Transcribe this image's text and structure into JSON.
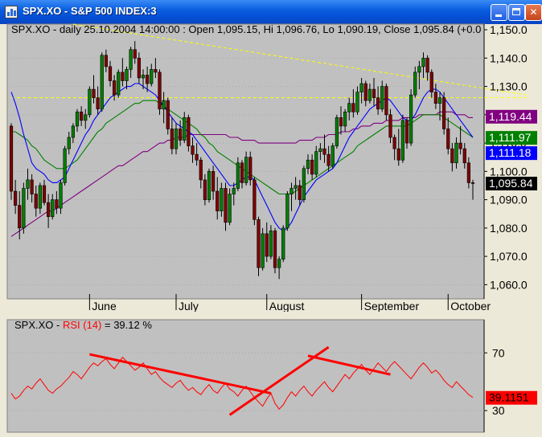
{
  "window": {
    "title": "SPX.XO - S&P 500 INDEX:3",
    "icons": [
      "chart-app-icon",
      "minimize-icon",
      "maximize-icon",
      "close-icon"
    ]
  },
  "price_panel": {
    "header": "SPX.XO - daily 25.10.2004 14:00:00 : Open 1,095.15, Hi 1,096.76, Lo 1,090.19, Close 1,095.84 (+0.0",
    "labels": [
      {
        "text": "1,119.44",
        "value": 1119.44,
        "color": "#800080"
      },
      {
        "text": "1,111.97",
        "value": 1111.97,
        "color": "#008000"
      },
      {
        "text": "1,111.18",
        "value": 1111.18,
        "color": "#0000ff"
      },
      {
        "text": "1,095.84",
        "value": 1095.84,
        "color": "#000000"
      }
    ]
  },
  "rsi_panel": {
    "header_prefix": "SPX.XO - ",
    "header_indicator": "RSI (14)",
    "header_suffix": " = 39.12 %",
    "value_label": "39.1151",
    "value": 39.1151
  },
  "colors": {
    "plot_bg": "#c0c0c0",
    "up_candle": "#008000",
    "down_candle": "#800000",
    "ma_blue": "#0000ff",
    "ma_green": "#008000",
    "ma_purple": "#800080",
    "trendline_yellow": "#ffff00",
    "rsi_line": "#ff0000"
  },
  "chart_data": [
    {
      "type": "candlestick",
      "ylim": [
        1055,
        1152
      ],
      "yticks": [
        1060,
        1070,
        1080,
        1090,
        1100,
        1110,
        1120,
        1130,
        1140,
        1150
      ],
      "ytick_labels": [
        "1,060.0",
        "1,070.0",
        "1,080.0",
        "1,090.0",
        "1,100.0",
        "1,110.0",
        "1,120.0",
        "1,130.0",
        "1,140.0",
        "1,150.0"
      ],
      "month_labels": [
        {
          "label": "June",
          "index": 19
        },
        {
          "label": "July",
          "index": 40
        },
        {
          "label": "August",
          "index": 62
        },
        {
          "label": "September",
          "index": 85
        },
        {
          "label": "October",
          "index": 106
        }
      ],
      "ohlc": [
        [
          1116,
          1117,
          1090,
          1093
        ],
        [
          1093,
          1097,
          1085,
          1088
        ],
        [
          1088,
          1093,
          1076,
          1080
        ],
        [
          1080,
          1096,
          1078,
          1094
        ],
        [
          1094,
          1101,
          1090,
          1097
        ],
        [
          1097,
          1099,
          1089,
          1092
        ],
        [
          1092,
          1095,
          1084,
          1087
        ],
        [
          1087,
          1096,
          1085,
          1095
        ],
        [
          1095,
          1097,
          1088,
          1089
        ],
        [
          1089,
          1092,
          1080,
          1084
        ],
        [
          1084,
          1092,
          1083,
          1090
        ],
        [
          1090,
          1093,
          1085,
          1087
        ],
        [
          1087,
          1097,
          1085,
          1096
        ],
        [
          1096,
          1109,
          1095,
          1108
        ],
        [
          1108,
          1114,
          1106,
          1112
        ],
        [
          1112,
          1117,
          1110,
          1116
        ],
        [
          1116,
          1122,
          1114,
          1121
        ],
        [
          1121,
          1123,
          1116,
          1118
        ],
        [
          1118,
          1122,
          1115,
          1120
        ],
        [
          1120,
          1130,
          1119,
          1129
        ],
        [
          1129,
          1134,
          1124,
          1126
        ],
        [
          1126,
          1130,
          1120,
          1122
        ],
        [
          1122,
          1142,
          1121,
          1141
        ],
        [
          1141,
          1143,
          1135,
          1137
        ],
        [
          1137,
          1139,
          1130,
          1132
        ],
        [
          1132,
          1134,
          1125,
          1127
        ],
        [
          1127,
          1136,
          1126,
          1135
        ],
        [
          1135,
          1140,
          1130,
          1132
        ],
        [
          1132,
          1137,
          1129,
          1136
        ],
        [
          1136,
          1144,
          1133,
          1143
        ],
        [
          1143,
          1146,
          1138,
          1140
        ],
        [
          1140,
          1142,
          1131,
          1133
        ],
        [
          1133,
          1136,
          1129,
          1134
        ],
        [
          1134,
          1137,
          1128,
          1131
        ],
        [
          1131,
          1138,
          1130,
          1136
        ],
        [
          1136,
          1140,
          1133,
          1135
        ],
        [
          1135,
          1136,
          1120,
          1122
        ],
        [
          1122,
          1128,
          1117,
          1125
        ],
        [
          1125,
          1126,
          1113,
          1115
        ],
        [
          1115,
          1119,
          1106,
          1108
        ],
        [
          1108,
          1117,
          1106,
          1115
        ],
        [
          1115,
          1118,
          1109,
          1111
        ],
        [
          1111,
          1121,
          1110,
          1119
        ],
        [
          1119,
          1120,
          1107,
          1109
        ],
        [
          1109,
          1112,
          1103,
          1106
        ],
        [
          1106,
          1110,
          1102,
          1104
        ],
        [
          1104,
          1105,
          1094,
          1097
        ],
        [
          1097,
          1099,
          1088,
          1090
        ],
        [
          1090,
          1101,
          1089,
          1100
        ],
        [
          1100,
          1102,
          1090,
          1093
        ],
        [
          1093,
          1098,
          1083,
          1086
        ],
        [
          1086,
          1096,
          1084,
          1094
        ],
        [
          1094,
          1096,
          1079,
          1082
        ],
        [
          1082,
          1094,
          1081,
          1092
        ],
        [
          1092,
          1096,
          1088,
          1094
        ],
        [
          1094,
          1105,
          1093,
          1103
        ],
        [
          1103,
          1104,
          1094,
          1096
        ],
        [
          1096,
          1107,
          1095,
          1105
        ],
        [
          1105,
          1107,
          1095,
          1097
        ],
        [
          1097,
          1098,
          1081,
          1083
        ],
        [
          1083,
          1084,
          1063,
          1066
        ],
        [
          1066,
          1080,
          1065,
          1078
        ],
        [
          1078,
          1082,
          1068,
          1070
        ],
        [
          1070,
          1081,
          1069,
          1079
        ],
        [
          1079,
          1080,
          1064,
          1066
        ],
        [
          1066,
          1070,
          1062,
          1069
        ],
        [
          1069,
          1081,
          1068,
          1080
        ],
        [
          1080,
          1093,
          1079,
          1092
        ],
        [
          1092,
          1096,
          1086,
          1094
        ],
        [
          1094,
          1098,
          1090,
          1095
        ],
        [
          1095,
          1097,
          1088,
          1090
        ],
        [
          1090,
          1102,
          1089,
          1101
        ],
        [
          1101,
          1106,
          1099,
          1104
        ],
        [
          1104,
          1106,
          1097,
          1099
        ],
        [
          1099,
          1109,
          1098,
          1107
        ],
        [
          1107,
          1110,
          1104,
          1108
        ],
        [
          1108,
          1113,
          1103,
          1106
        ],
        [
          1106,
          1109,
          1100,
          1102
        ],
        [
          1102,
          1110,
          1101,
          1109
        ],
        [
          1109,
          1120,
          1108,
          1119
        ],
        [
          1119,
          1123,
          1113,
          1116
        ],
        [
          1116,
          1122,
          1114,
          1121
        ],
        [
          1121,
          1126,
          1118,
          1124
        ],
        [
          1124,
          1129,
          1119,
          1121
        ],
        [
          1121,
          1130,
          1120,
          1128
        ],
        [
          1128,
          1133,
          1124,
          1131
        ],
        [
          1131,
          1132,
          1123,
          1125
        ],
        [
          1125,
          1131,
          1124,
          1129
        ],
        [
          1129,
          1133,
          1123,
          1126
        ],
        [
          1126,
          1130,
          1120,
          1122
        ],
        [
          1122,
          1132,
          1121,
          1130
        ],
        [
          1130,
          1131,
          1118,
          1120
        ],
        [
          1120,
          1122,
          1110,
          1112
        ],
        [
          1112,
          1113,
          1104,
          1108
        ],
        [
          1108,
          1115,
          1102,
          1104
        ],
        [
          1104,
          1120,
          1103,
          1118
        ],
        [
          1118,
          1119,
          1108,
          1110
        ],
        [
          1110,
          1129,
          1109,
          1127
        ],
        [
          1127,
          1137,
          1126,
          1135
        ],
        [
          1135,
          1139,
          1129,
          1137
        ],
        [
          1137,
          1142,
          1133,
          1140
        ],
        [
          1140,
          1141,
          1132,
          1135
        ],
        [
          1135,
          1136,
          1126,
          1128
        ],
        [
          1128,
          1131,
          1122,
          1124
        ],
        [
          1124,
          1128,
          1118,
          1126
        ],
        [
          1126,
          1128,
          1113,
          1115
        ],
        [
          1115,
          1119,
          1106,
          1108
        ],
        [
          1108,
          1110,
          1100,
          1103
        ],
        [
          1103,
          1112,
          1101,
          1110
        ],
        [
          1110,
          1116,
          1106,
          1108
        ],
        [
          1108,
          1110,
          1101,
          1103
        ],
        [
          1103,
          1105,
          1094,
          1096
        ],
        [
          1096,
          1097,
          1090,
          1095.84
        ]
      ],
      "ma_blue": [
        1128,
        1124,
        1119,
        1113,
        1108,
        1103,
        1101,
        1100,
        1099,
        1097,
        1096,
        1096,
        1097,
        1098,
        1101,
        1104,
        1107,
        1110,
        1113,
        1115,
        1118,
        1120,
        1122,
        1124,
        1126,
        1127,
        1128,
        1129,
        1130,
        1130,
        1131,
        1131,
        1130,
        1129,
        1128,
        1127,
        1125,
        1123,
        1121,
        1119,
        1117,
        1116,
        1115,
        1114,
        1113,
        1111,
        1109,
        1107,
        1105,
        1103,
        1101,
        1099,
        1097,
        1095,
        1095,
        1096,
        1097,
        1098,
        1098,
        1097,
        1094,
        1091,
        1088,
        1085,
        1082,
        1080,
        1079,
        1080,
        1082,
        1085,
        1088,
        1091,
        1093,
        1095,
        1097,
        1098,
        1099,
        1100,
        1101,
        1103,
        1106,
        1109,
        1112,
        1114,
        1116,
        1118,
        1120,
        1122,
        1123,
        1124,
        1125,
        1126,
        1125,
        1123,
        1121,
        1119,
        1118,
        1118,
        1120,
        1123,
        1126,
        1128,
        1129,
        1129,
        1128,
        1126,
        1124,
        1122,
        1120,
        1118,
        1116,
        1114,
        1112
      ],
      "ma_green": [
        1114,
        1114,
        1113,
        1112,
        1111,
        1109,
        1108,
        1106,
        1104,
        1103,
        1102,
        1101,
        1101,
        1101,
        1102,
        1103,
        1104,
        1106,
        1108,
        1110,
        1112,
        1114,
        1115,
        1117,
        1118,
        1119,
        1120,
        1121,
        1122,
        1123,
        1124,
        1124,
        1125,
        1125,
        1125,
        1125,
        1124,
        1123,
        1122,
        1121,
        1120,
        1119,
        1118,
        1117,
        1116,
        1115,
        1113,
        1112,
        1110,
        1109,
        1107,
        1106,
        1105,
        1104,
        1103,
        1102,
        1101,
        1100,
        1099,
        1098,
        1097,
        1096,
        1095,
        1094,
        1093,
        1092,
        1092,
        1092,
        1092,
        1093,
        1094,
        1095,
        1096,
        1097,
        1098,
        1099,
        1100,
        1101,
        1102,
        1103,
        1104,
        1105,
        1106,
        1107,
        1109,
        1110,
        1111,
        1112,
        1113,
        1114,
        1115,
        1116,
        1116,
        1116,
        1116,
        1116,
        1116,
        1117,
        1118,
        1119,
        1120,
        1120,
        1120,
        1120,
        1120,
        1119,
        1118,
        1117,
        1116,
        1115,
        1114,
        1113,
        1112
      ],
      "ma_purple": [
        1077,
        1078,
        1079,
        1080,
        1081,
        1082,
        1083,
        1084,
        1085,
        1086,
        1086,
        1087,
        1088,
        1089,
        1090,
        1091,
        1092,
        1093,
        1094,
        1095,
        1096,
        1097,
        1098,
        1099,
        1100,
        1101,
        1102,
        1102,
        1103,
        1104,
        1105,
        1106,
        1107,
        1107,
        1108,
        1109,
        1110,
        1110,
        1111,
        1111,
        1112,
        1112,
        1112,
        1113,
        1113,
        1113,
        1113,
        1113,
        1113,
        1113,
        1113,
        1113,
        1113,
        1112,
        1112,
        1112,
        1111,
        1111,
        1111,
        1111,
        1110,
        1110,
        1110,
        1110,
        1110,
        1110,
        1110,
        1110,
        1110,
        1110,
        1111,
        1111,
        1111,
        1111,
        1112,
        1112,
        1112,
        1113,
        1113,
        1113,
        1114,
        1114,
        1114,
        1115,
        1115,
        1116,
        1116,
        1116,
        1117,
        1117,
        1117,
        1118,
        1118,
        1118,
        1118,
        1119,
        1119,
        1119,
        1119,
        1120,
        1120,
        1120,
        1120,
        1120,
        1121,
        1121,
        1121,
        1121,
        1120,
        1120,
        1120,
        1119,
        1119
      ],
      "trendlines": [
        {
          "color": "#ffff00",
          "style": "dashed",
          "from": [
            15,
            1152
          ],
          "to": [
            125,
            1127
          ]
        },
        {
          "color": "#ffff00",
          "style": "dashed",
          "from": [
            0,
            1126
          ],
          "to": [
            125,
            1126
          ]
        }
      ]
    },
    {
      "type": "line",
      "ylim": [
        15,
        93
      ],
      "yticks": [
        30,
        70
      ],
      "ytick_labels": [
        "30",
        "70"
      ],
      "series": [
        {
          "values": [
            42,
            38,
            40,
            44,
            47,
            45,
            49,
            52,
            48,
            44,
            42,
            45,
            47,
            50,
            53,
            57,
            55,
            52,
            56,
            60,
            63,
            61,
            64,
            66,
            62,
            59,
            63,
            67,
            64,
            61,
            58,
            60,
            63,
            59,
            55,
            57,
            53,
            50,
            48,
            46,
            49,
            51,
            47,
            44,
            46,
            43,
            41,
            45,
            48,
            44,
            42,
            46,
            49,
            45,
            43,
            40,
            44,
            47,
            43,
            39,
            36,
            33,
            38,
            42,
            35,
            31,
            34,
            39,
            43,
            40,
            44,
            47,
            43,
            40,
            44,
            47,
            50,
            46,
            43,
            47,
            51,
            55,
            52,
            56,
            59,
            62,
            58,
            55,
            59,
            63,
            60,
            57,
            61,
            64,
            61,
            58,
            55,
            52,
            56,
            60,
            63,
            60,
            56,
            58,
            55,
            51,
            48,
            46,
            50,
            47,
            44,
            41,
            39
          ]
        }
      ],
      "trendlines": [
        {
          "color": "#ff0000",
          "from": [
            19,
            69
          ],
          "to": [
            63,
            42
          ]
        },
        {
          "color": "#ff0000",
          "from": [
            53,
            27
          ],
          "to": [
            77,
            74
          ]
        },
        {
          "color": "#ff0000",
          "from": [
            72,
            68
          ],
          "to": [
            92,
            55
          ]
        }
      ]
    }
  ]
}
